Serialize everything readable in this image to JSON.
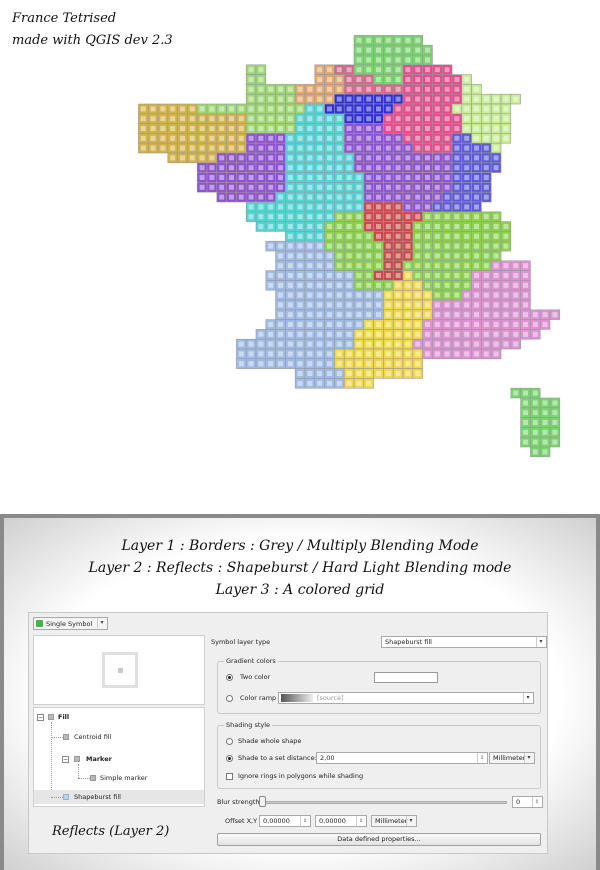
{
  "map": {
    "title_line1": "France Tetrised",
    "title_line2": "made with QGIS dev 2.3",
    "region_colors": {
      "A": "#79d36f",
      "B": "#e0a76f",
      "C": "#d4688b",
      "D": "#e84a8c",
      "E": "#9ed874",
      "F": "#c8ee96",
      "G": "#2f2fd6",
      "H": "#d4b24a",
      "I": "#54d4d6",
      "J": "#8e52d0",
      "K": "#5e5ad6",
      "L": "#c84a4a",
      "M": "#8bd24e",
      "N": "#9fbbe6",
      "O": "#f0d84a",
      "P": "#dd92d3"
    },
    "grid_rows": [
      "................................................",
      "..................................................",
      "..................................................",
      "..............................AAAAAAA.............",
      "..............................AAAAAAAA............",
      "..............................AAAAAAAA............",
      "...................EE.....BBCCAAAAADDDDD..........",
      "...................EE.....BBBCCCAAADDDDDDF........",
      "...................EEEEEBBBBBCCCCCCDDDDDDFF.......",
      "...................EEEEEBBBBGGGGGGGDDDDDDFFFFFF...",
      "........HHHHHHEEEEEEEEEEEIIGGGGGGGDDDDDDFFFFFF...",
      "........HHHHHHHHHHHEEEEEIIIIIGGGGDDDDDDDDFFFFF...",
      "........HHHHHHHHHHHEEEEEIIIIIJJJJDDDDDDDDFFFFF...",
      "........HHHHHHHHHHHJJJJIIIIIIJJJJJJDDDDDKKFFFF...",
      "........HHHHHHHHHHHJJJJIIIIIIJJJJJJJDDDDKKKKF....",
      "...........HHHHHJJJJJJJIIIIIIIJJJJJJJJJJKKKKK....",
      "..............JJJJJJJJJIIIIIIIJJJJJJJJJJKKKKK....",
      "..............JJJJJJJJJIIIIIIIIJJJJJJJJJKKKK.....",
      "..............JJJJJJJJJIIIIIIIIJJJJJJJJJKKKK.....",
      "................JJJJJJIIIIIIIIIJJJJJJJJKKKKK.....",
      "...................IIIIIIIIIIIILLLLJJJKKKKK.....",
      "...................IIIIIIIIIMMMLLLLLLMMMMMMMM....",
      "....................IIIIIIIMMMMLLLLLMMMMMMMMMM...",
      ".......................IIIIMMMMMLLLLMMMMMMMMMM....",
      ".....................NNNNNNMMMMMMLLLMMMMMMMMMM.....",
      "......................NNNNNNMMMMMLLLMMMMMMMMM......",
      "......................NNNNNNMMMMMLLMMMMMMMMMPPPP...",
      ".....................NNNNNNNNNMMLLLOMMMMMMPPPPPP..",
      ".....................NNNNNNNNNMMMMOOOMMMMMPPPPPP..",
      "......................NNNNNNNNNNNOOOOOMMMPPPPPPP..",
      "......................NNNNNNNNNNNOOOOOPPPPPPPPPP..",
      "......................NNNNNNNNNNNOOOOOPPPPPPPPPPPPP",
      ".....................NNNNNNNNNNOOOOOOPPPPPPPPPPPPP",
      "....................NNNNNNNNNNOOOOOOOPPPPPPPPPPPP.",
      "..................NNNNNNNNNNNNOOOOOOPPPPPPPPPPP...",
      "..................NNNNNNNNNNOOOOOOOOOPPPPPPPP.....",
      "..................NNNNNNNNNNOOOOOOOOO............",
      "........................NNNNNOOOOOOOO............",
      "........................NNNNNOOO.................",
      "..............................................AAA",
      "...............................................AAAA",
      "...............................................AAAA",
      "...............................................AAAA",
      "...............................................AAAA",
      "...............................................AAAA",
      "................................................AA"
    ]
  },
  "captions": {
    "line1": "Layer 1 : Borders : Grey / Multiply Blending Mode",
    "line2": "Layer 2 : Reflects : Shapeburst / Hard Light Blending mode",
    "line3": "Layer 3 : A colored grid"
  },
  "dialog": {
    "renderer_select": "Single Symbol",
    "symbol_layer_type_label": "Symbol layer type",
    "symbol_layer_type_value": "Shapeburst fill",
    "gradient_group": "Gradient colors",
    "two_color_label": "Two color",
    "two_color_selected": true,
    "color_ramp_label": "Color ramp",
    "color_ramp_value": "[source]",
    "shading_group": "Shading style",
    "shade_whole_label": "Shade whole shape",
    "shade_distance_label": "Shade to a set distance:",
    "shade_distance_value": "2,00",
    "shade_unit": "Millimeter",
    "ignore_rings_label": "Ignore rings in polygons while shading",
    "blur_label": "Blur strength",
    "blur_value": "0",
    "offset_label": "Offset X,Y",
    "offset_x": "0,00000",
    "offset_y": "0,00000",
    "offset_unit": "Millimeter",
    "data_defined_button": "Data defined properties...",
    "tree": {
      "fill": "Fill",
      "centroid_fill": "Centroid fill",
      "marker": "Marker",
      "simple_marker": "Simple marker",
      "shapeburst_fill": "Shapeburst fill"
    },
    "reflects_label": "Reflects (Layer 2)"
  }
}
